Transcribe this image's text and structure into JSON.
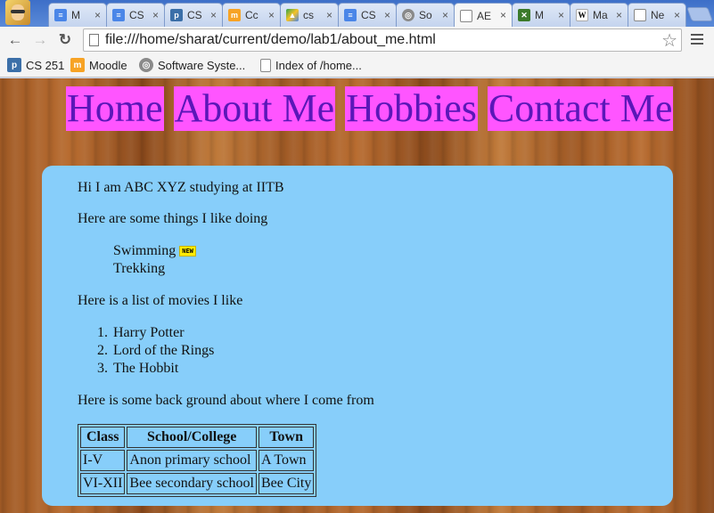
{
  "browser": {
    "tabs": [
      {
        "label": "M",
        "icon": "docs-icon",
        "color": "#4a86e8"
      },
      {
        "label": "CS",
        "icon": "docs-icon",
        "color": "#4a86e8"
      },
      {
        "label": "CS",
        "icon": "piazza-icon",
        "color": "#3b6fa8"
      },
      {
        "label": "Cc",
        "icon": "moodle-icon",
        "color": "#f7a325"
      },
      {
        "label": "cs",
        "icon": "drive-icon",
        "color": "#2ea44f"
      },
      {
        "label": "CS",
        "icon": "docs-icon",
        "color": "#4a86e8"
      },
      {
        "label": "So",
        "icon": "seal-icon",
        "color": "#8a8a8a"
      },
      {
        "label": "AE",
        "icon": "page-icon",
        "color": "#ffffff"
      },
      {
        "label": "M",
        "icon": "minecraft-icon",
        "color": "#3b7a2a"
      },
      {
        "label": "Ma",
        "icon": "wikipedia-icon",
        "color": "#ffffff"
      },
      {
        "label": "Ne",
        "icon": "page-icon",
        "color": "#ffffff"
      }
    ],
    "close_glyph": "×",
    "url": "file:///home/sharat/current/demo/lab1/about_me.html",
    "bookmarks": [
      {
        "label": "CS 251",
        "icon": "piazza-icon"
      },
      {
        "label": "Moodle",
        "icon": "moodle-icon"
      },
      {
        "label": "Software Syste...",
        "icon": "seal-icon"
      },
      {
        "label": "Index of /home...",
        "icon": "page-icon"
      }
    ]
  },
  "page": {
    "nav": [
      "Home",
      "About Me",
      "Hobbies",
      "Contact Me"
    ],
    "nav_colors": {
      "background": "#ff55ff",
      "text": "#5b17b8"
    },
    "intro": "Hi I am ABC XYZ studying at IITB",
    "likes_heading": "Here are some things I like doing",
    "likes": [
      "Swimming",
      "Trekking"
    ],
    "new_badge": "NEW",
    "movies_heading": "Here is a list of movies I like",
    "movies": [
      "Harry Potter",
      "Lord of the Rings",
      "The Hobbit"
    ],
    "movie_numbers": [
      "1.",
      "2.",
      "3."
    ],
    "background_heading": "Here is some back ground about where I come from",
    "table": {
      "headers": [
        "Class",
        "School/College",
        "Town"
      ],
      "rows": [
        [
          "I-V",
          "Anon primary school",
          "A Town"
        ],
        [
          "VI-XII",
          "Bee secondary school",
          "Bee City"
        ]
      ]
    },
    "card_color": "#87cefa"
  }
}
